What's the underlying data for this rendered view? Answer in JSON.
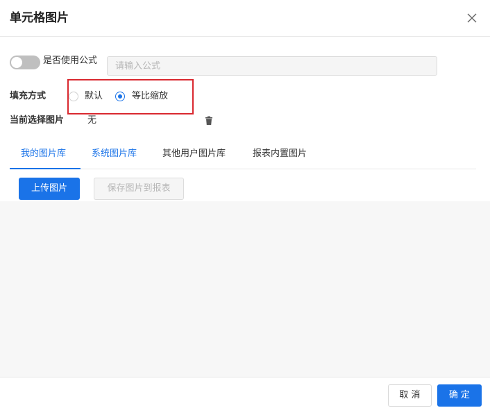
{
  "dialog": {
    "title": "单元格图片",
    "close_icon": "close-icon"
  },
  "formula": {
    "switch_on": false,
    "label": "是否使用公式",
    "placeholder": "请输入公式"
  },
  "fill_mode": {
    "label": "填充方式",
    "options": [
      {
        "label": "默认",
        "checked": false
      },
      {
        "label": "等比缩放",
        "checked": true
      }
    ]
  },
  "current_image": {
    "label": "当前选择图片",
    "value": "无",
    "delete_icon": "trash-icon"
  },
  "tabs": [
    {
      "label": "我的图片库",
      "active": true
    },
    {
      "label": "系统图片库",
      "active": false
    },
    {
      "label": "其他用户图片库",
      "active": false
    },
    {
      "label": "报表内置图片",
      "active": false
    }
  ],
  "actions": {
    "upload_label": "上传图片",
    "save_to_report_label": "保存图片到报表"
  },
  "footer": {
    "cancel_label": "取 消",
    "confirm_label": "确 定"
  },
  "colors": {
    "accent": "#1a73e8",
    "highlight": "#d9282f"
  }
}
